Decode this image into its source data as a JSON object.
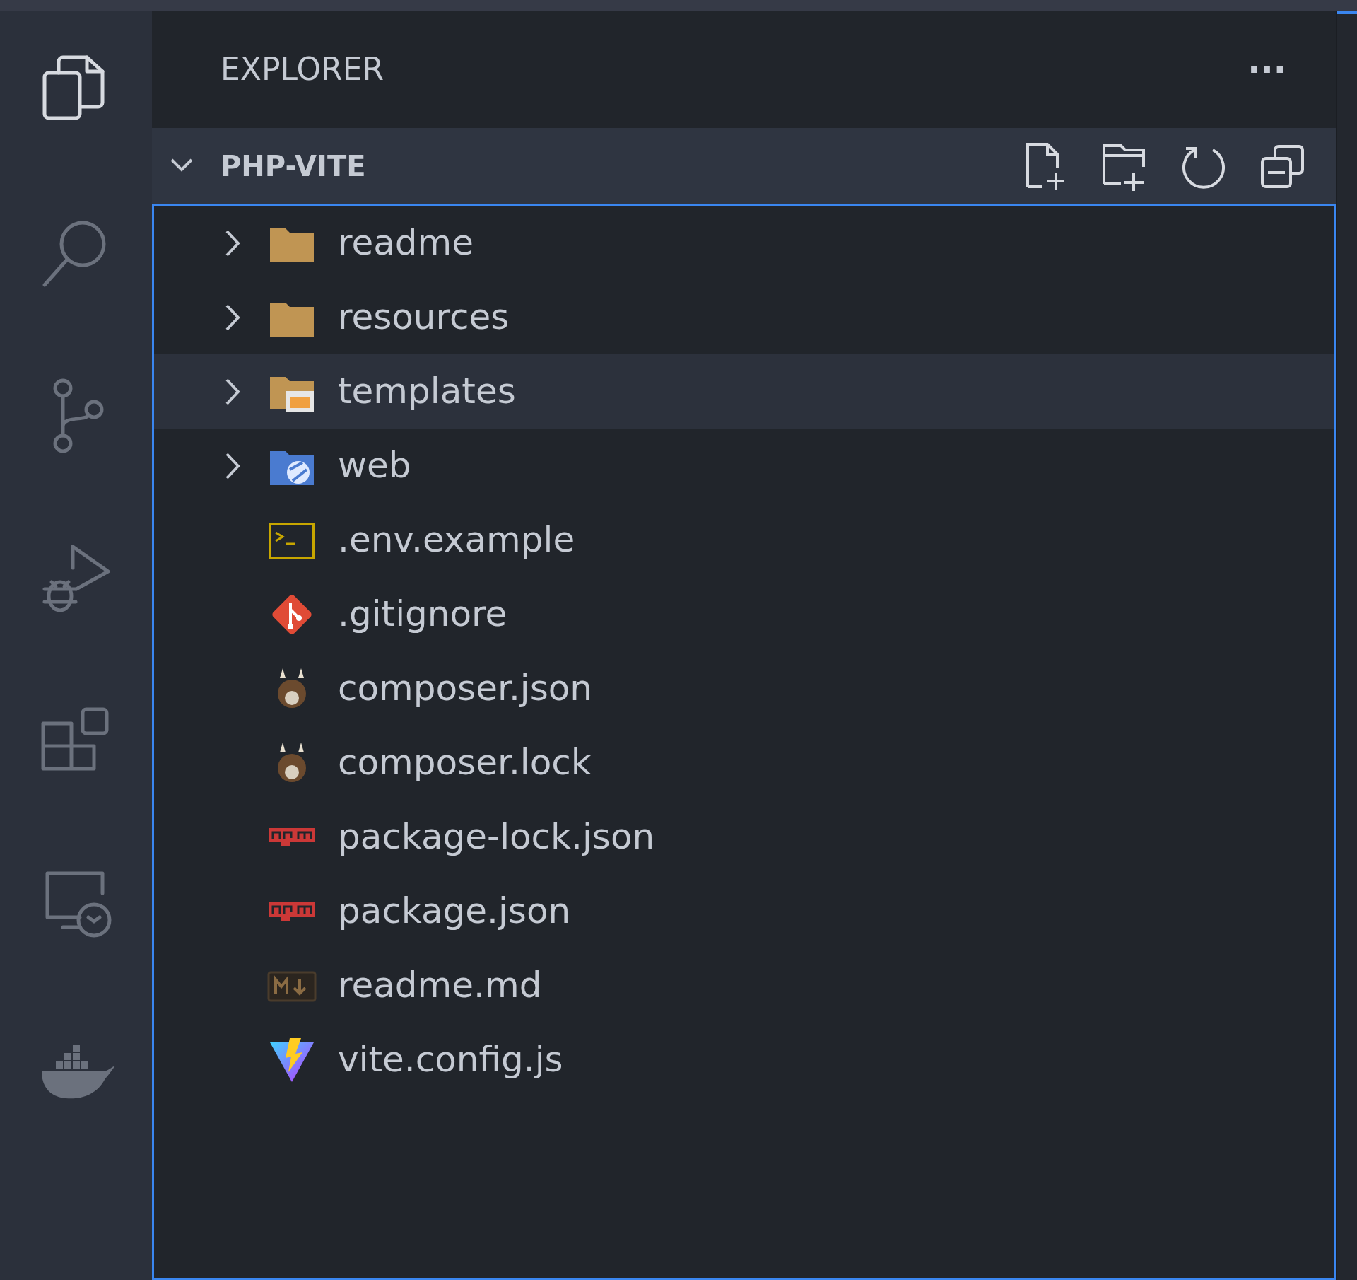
{
  "activity_bar": [
    {
      "kind": "files",
      "selected": true
    },
    {
      "kind": "search",
      "selected": false
    },
    {
      "kind": "source-control",
      "selected": false
    },
    {
      "kind": "run-debug",
      "selected": false
    },
    {
      "kind": "extensions",
      "selected": false
    },
    {
      "kind": "remote",
      "selected": false
    },
    {
      "kind": "docker",
      "selected": false
    }
  ],
  "sidebar": {
    "title": "EXPLORER",
    "more": "···"
  },
  "section": {
    "title": "PHP-VITE",
    "expanded": true
  },
  "tree": [
    {
      "name": "readme",
      "kind": "folder",
      "expanded": false,
      "selected": false
    },
    {
      "name": "resources",
      "kind": "folder",
      "expanded": false,
      "selected": false
    },
    {
      "name": "templates",
      "kind": "templates-folder",
      "expanded": false,
      "selected": true
    },
    {
      "name": "web",
      "kind": "web-folder",
      "expanded": false,
      "selected": false
    },
    {
      "name": ".env.example",
      "kind": "terminal-file",
      "selected": false
    },
    {
      "name": ".gitignore",
      "kind": "git-file",
      "selected": false
    },
    {
      "name": "composer.json",
      "kind": "composer-file",
      "selected": false
    },
    {
      "name": "composer.lock",
      "kind": "composer-file",
      "selected": false
    },
    {
      "name": "package-lock.json",
      "kind": "npm-file",
      "selected": false
    },
    {
      "name": "package.json",
      "kind": "npm-file",
      "selected": false
    },
    {
      "name": "readme.md",
      "kind": "markdown-file",
      "selected": false
    },
    {
      "name": "vite.config.js",
      "kind": "vite-file",
      "selected": false
    }
  ]
}
